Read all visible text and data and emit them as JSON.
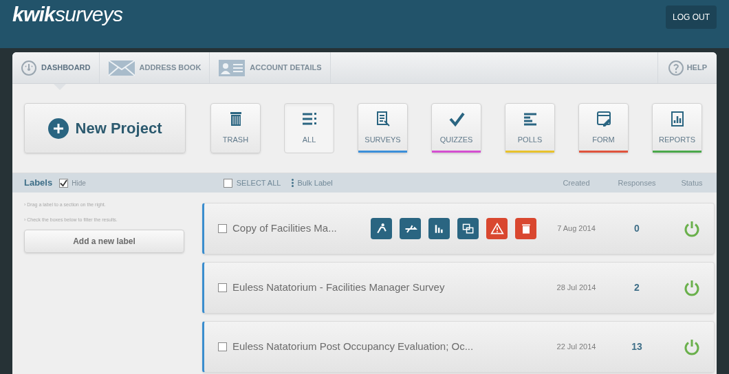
{
  "header": {
    "logo_bold": "kwik",
    "logo_light": "surveys",
    "logout": "LOG OUT"
  },
  "tabs": [
    {
      "label": "DASHBOARD",
      "kind": "gauge",
      "selected": true
    },
    {
      "label": "ADDRESS BOOK",
      "kind": "envelope",
      "selected": false
    },
    {
      "label": "ACCOUNT DETAILS",
      "kind": "card",
      "selected": false
    }
  ],
  "help": "HELP",
  "new_project": "New Project",
  "filters": [
    {
      "label": "TRASH",
      "kind": "trash",
      "selected": false
    },
    {
      "label": "ALL",
      "kind": "list",
      "selected": true
    },
    {
      "label": "SURVEYS",
      "kind": "doc",
      "selected": false,
      "color": "#3b8fd9"
    },
    {
      "label": "QUIZZES",
      "kind": "check",
      "selected": false,
      "color": "#d44fd0"
    },
    {
      "label": "POLLS",
      "kind": "lines",
      "selected": false,
      "color": "#e8c22c"
    },
    {
      "label": "FORM",
      "kind": "form",
      "selected": false,
      "color": "#e0533c"
    },
    {
      "label": "REPORTS",
      "kind": "report",
      "selected": false,
      "color": "#4aa84a"
    }
  ],
  "labels_bar": {
    "title": "Labels",
    "hide_checked": true,
    "hide": "Hide",
    "select_all": "SELECT ALL",
    "select_all_checked": false,
    "bulk_label": "Bulk Label",
    "columns": [
      "Created",
      "Responses",
      "Status"
    ]
  },
  "sidebar": {
    "hints": [
      "› Drag a label to a section on the right.",
      "› Check the boxes below to filter the results."
    ],
    "add_label": "Add a new label"
  },
  "projects": [
    {
      "title": "Copy of Facilities Ma...",
      "checked": false,
      "created": "7 Aug 2014",
      "responses": "0",
      "active": true,
      "actions": [
        {
          "kind": "person",
          "color": "#2a6581"
        },
        {
          "kind": "plane",
          "color": "#2a6581"
        },
        {
          "kind": "bars",
          "color": "#2a6581"
        },
        {
          "kind": "copy",
          "color": "#2a6581"
        },
        {
          "kind": "warning",
          "color": "#d9472f"
        },
        {
          "kind": "trash",
          "color": "#d9472f"
        }
      ]
    },
    {
      "title": "Euless Natatorium - Facilities Manager Survey",
      "checked": false,
      "created": "28 Jul 2014",
      "responses": "2",
      "active": true
    },
    {
      "title": "Euless Natatorium Post Occupancy Evaluation; Oc...",
      "checked": false,
      "created": "22 Jul 2014",
      "responses": "13",
      "active": true
    }
  ]
}
